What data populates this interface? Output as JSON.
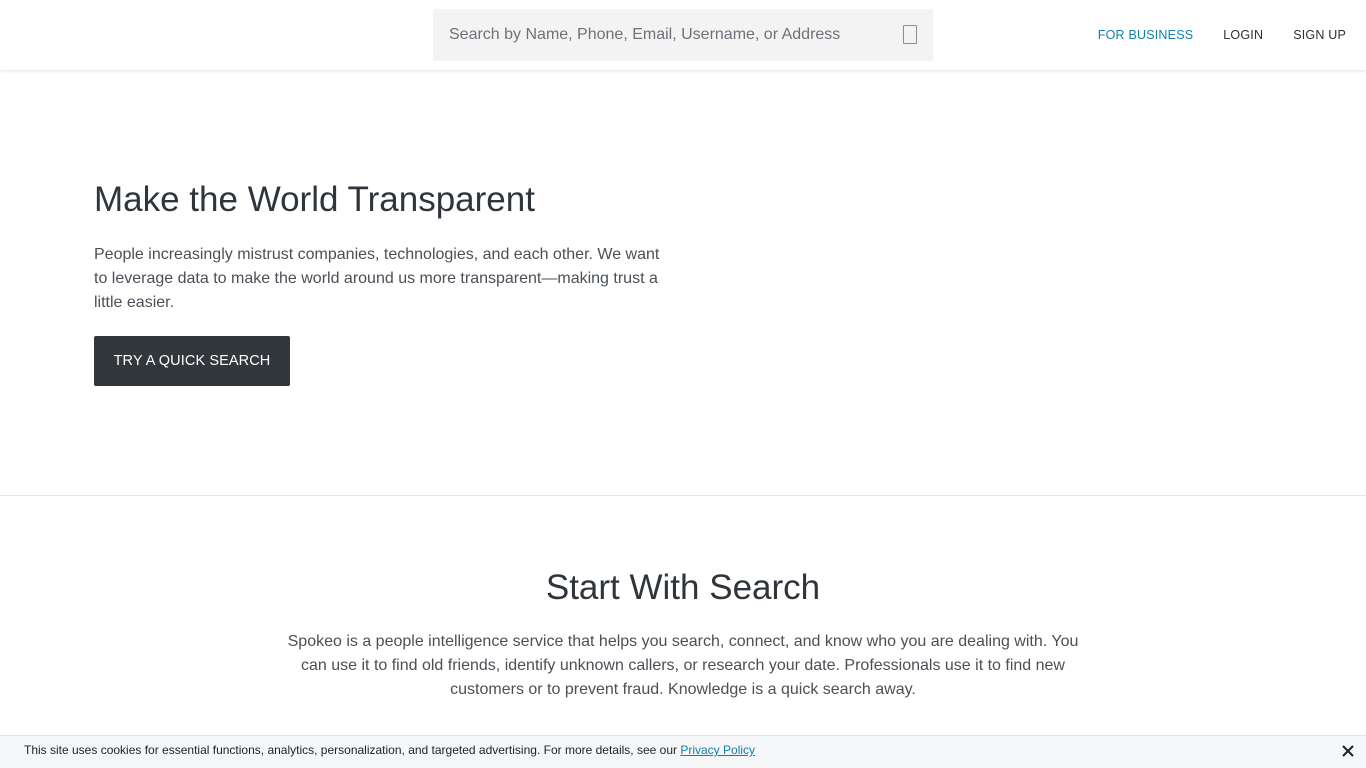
{
  "header": {
    "search": {
      "placeholder": "Search by Name, Phone, Email, Username, or Address",
      "value": ""
    },
    "nav": {
      "business_label": "FOR BUSINESS",
      "login_label": "LOGIN",
      "signup_label": "SIGN UP"
    }
  },
  "hero": {
    "title": "Make the World Transparent",
    "text": "People increasingly mistrust companies, technologies, and each other. We want to leverage data to make the world around us more transparent—making trust a little easier.",
    "button_label": "TRY A QUICK SEARCH"
  },
  "search_section": {
    "title": "Start With Search",
    "text": "Spokeo is a people intelligence service that helps you search, connect, and know who you are dealing with. You can use it to find old friends, identify unknown callers, or research your date. Professionals use it to find new customers or to prevent fraud. Knowledge is a quick search away."
  },
  "cookie_bar": {
    "text": "This site uses cookies for essential functions, analytics, personalization, and targeted advertising. For more details, see our ",
    "link_label": "Privacy Policy",
    "close_icon": "close-icon"
  },
  "colors": {
    "accent": "#137fa8",
    "button_bg": "#32373c",
    "search_bg": "#f3f3f4",
    "cookie_bg": "#f4f6f8"
  }
}
